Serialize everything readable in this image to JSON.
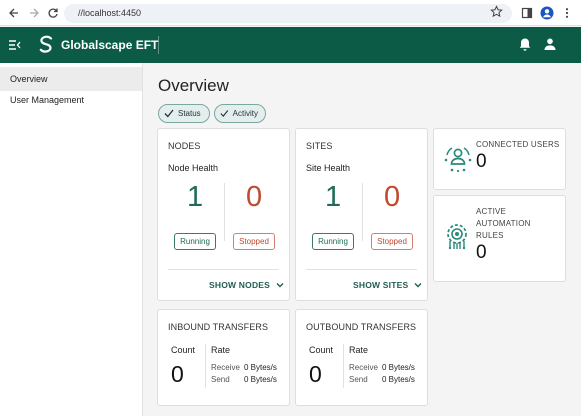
{
  "browser": {
    "url": "//localhost:4450"
  },
  "header": {
    "app_title": "Globalscape EFT"
  },
  "sidebar": {
    "items": [
      {
        "label": "Overview"
      },
      {
        "label": "User Management"
      }
    ]
  },
  "main": {
    "title": "Overview",
    "chips": [
      {
        "label": "Status"
      },
      {
        "label": "Activity"
      }
    ],
    "nodes": {
      "title": "NODES",
      "health_label": "Node Health",
      "running_count": "1",
      "stopped_count": "0",
      "running_label": "Running",
      "stopped_label": "Stopped",
      "show_link": "SHOW NODES"
    },
    "sites": {
      "title": "SITES",
      "health_label": "Site Health",
      "running_count": "1",
      "stopped_count": "0",
      "running_label": "Running",
      "stopped_label": "Stopped",
      "show_link": "SHOW SITES"
    },
    "connected_users": {
      "title": "CONNECTED USERS",
      "value": "0"
    },
    "automation_rules": {
      "title_line1": "ACTIVE",
      "title_line2": "AUTOMATION",
      "title_line3": "RULES",
      "value": "0"
    },
    "inbound": {
      "title": "INBOUND TRANSFERS",
      "count_label": "Count",
      "count_value": "0",
      "rate_label": "Rate",
      "receive_label": "Receive",
      "receive_value": "0 Bytes/s",
      "send_label": "Send",
      "send_value": "0 Bytes/s"
    },
    "outbound": {
      "title": "OUTBOUND TRANSFERS",
      "count_label": "Count",
      "count_value": "0",
      "rate_label": "Rate",
      "receive_label": "Receive",
      "receive_value": "0 Bytes/s",
      "send_label": "Send",
      "send_value": "0 Bytes/s"
    }
  },
  "colors": {
    "header_bg": "#0b5b46",
    "running_green": "#1f6b57",
    "stopped_red": "#c0492f",
    "icon_teal": "#2a8a7a"
  }
}
